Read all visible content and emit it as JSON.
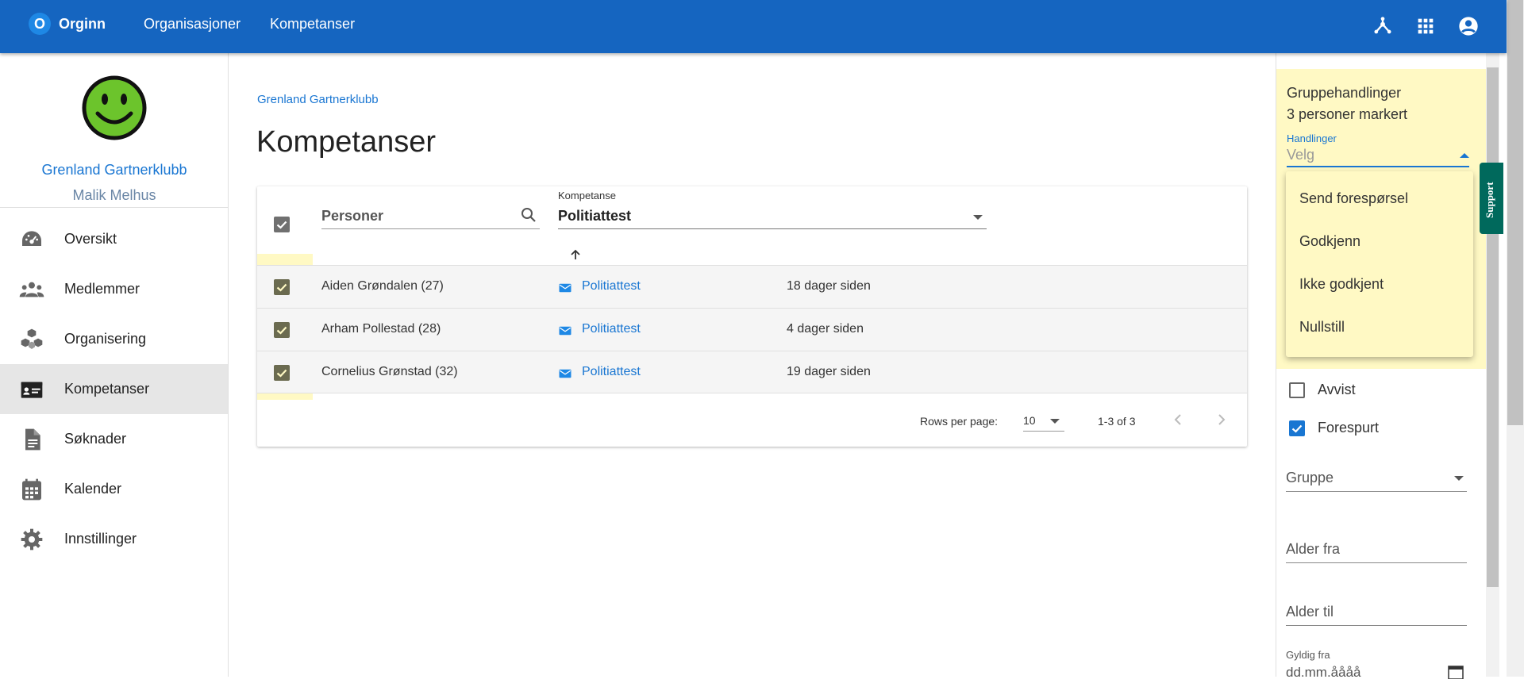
{
  "topbar": {
    "logo_letter": "O",
    "brand": "Orginn",
    "nav": [
      "Organisasjoner",
      "Kompetanser"
    ],
    "icons": [
      "hub-icon",
      "apps-grid-icon",
      "account-circle-icon"
    ],
    "color": "#1565c0"
  },
  "sidebar": {
    "club_name": "Grenland Gartnerklubb",
    "user_name": "Malik Melhus",
    "items": [
      {
        "label": "Oversikt",
        "icon": "dashboard-icon"
      },
      {
        "label": "Medlemmer",
        "icon": "people-icon"
      },
      {
        "label": "Organisering",
        "icon": "cubes-icon"
      },
      {
        "label": "Kompetanser",
        "icon": "id-card-icon",
        "active": true
      },
      {
        "label": "Søknader",
        "icon": "document-icon"
      },
      {
        "label": "Kalender",
        "icon": "calendar-icon"
      },
      {
        "label": "Innstillinger",
        "icon": "gear-icon"
      }
    ]
  },
  "main": {
    "breadcrumb": "Grenland Gartnerklubb",
    "title": "Kompetanser",
    "table": {
      "search_placeholder": "Personer",
      "competence_label": "Kompetanse",
      "competence_value": "Politiattest",
      "rows": [
        {
          "name": "Aiden Grøndalen (27)",
          "competence": "Politiattest",
          "date": "18 dager siden"
        },
        {
          "name": "Arham Pollestad (28)",
          "competence": "Politiattest",
          "date": "4 dager siden"
        },
        {
          "name": "Cornelius Grønstad (32)",
          "competence": "Politiattest",
          "date": "19 dager siden"
        }
      ],
      "rows_per_page_label": "Rows per page:",
      "rows_per_page": "10",
      "range": "1-3 of 3"
    }
  },
  "right_panel": {
    "bulk_title": "Gruppehandlinger",
    "bulk_count": "3 personer markert",
    "actions_label": "Handlinger",
    "actions_placeholder": "Velg",
    "menu": [
      "Send forespørsel",
      "Godkjenn",
      "Ikke godkjent",
      "Nullstill"
    ],
    "filters": [
      {
        "label": "Avvist",
        "checked": false
      },
      {
        "label": "Forespurt",
        "checked": true
      }
    ],
    "group_label": "Gruppe",
    "age_from": "Alder fra",
    "age_to": "Alder til",
    "valid_from_label": "Gyldig fra",
    "date_placeholder": "dd.mm.åååå",
    "support": "Support"
  },
  "colors": {
    "accent": "#1976d2",
    "highlight": "#fff9c4",
    "support": "#00695c"
  }
}
